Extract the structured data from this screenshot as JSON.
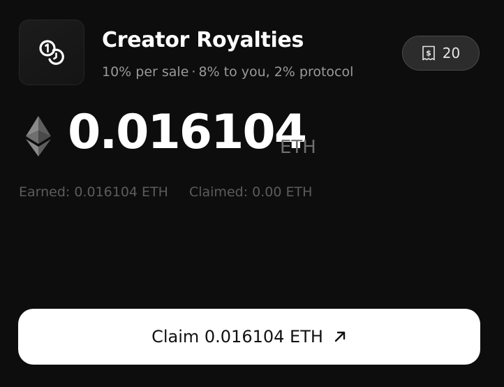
{
  "header": {
    "app_icon": "coins-icon",
    "title": "Creator Royalties",
    "subtitle": {
      "rate": "10% per sale",
      "separator": "·",
      "split": "8% to you, 2% protocol"
    }
  },
  "badge": {
    "icon": "receipt-icon",
    "count": "20"
  },
  "balance": {
    "icon": "ethereum-icon",
    "amount": "0.016104",
    "unit": "ETH"
  },
  "stats": {
    "earned": "Earned: 0.016104 ETH",
    "claimed": "Claimed: 0.00 ETH"
  },
  "claim_button": {
    "label": "Claim 0.016104 ETH",
    "icon": "arrow-up-right-icon"
  },
  "colors": {
    "background": "#0d0d0d",
    "button_bg": "#ffffff",
    "muted_text": "#9a9a9a"
  }
}
